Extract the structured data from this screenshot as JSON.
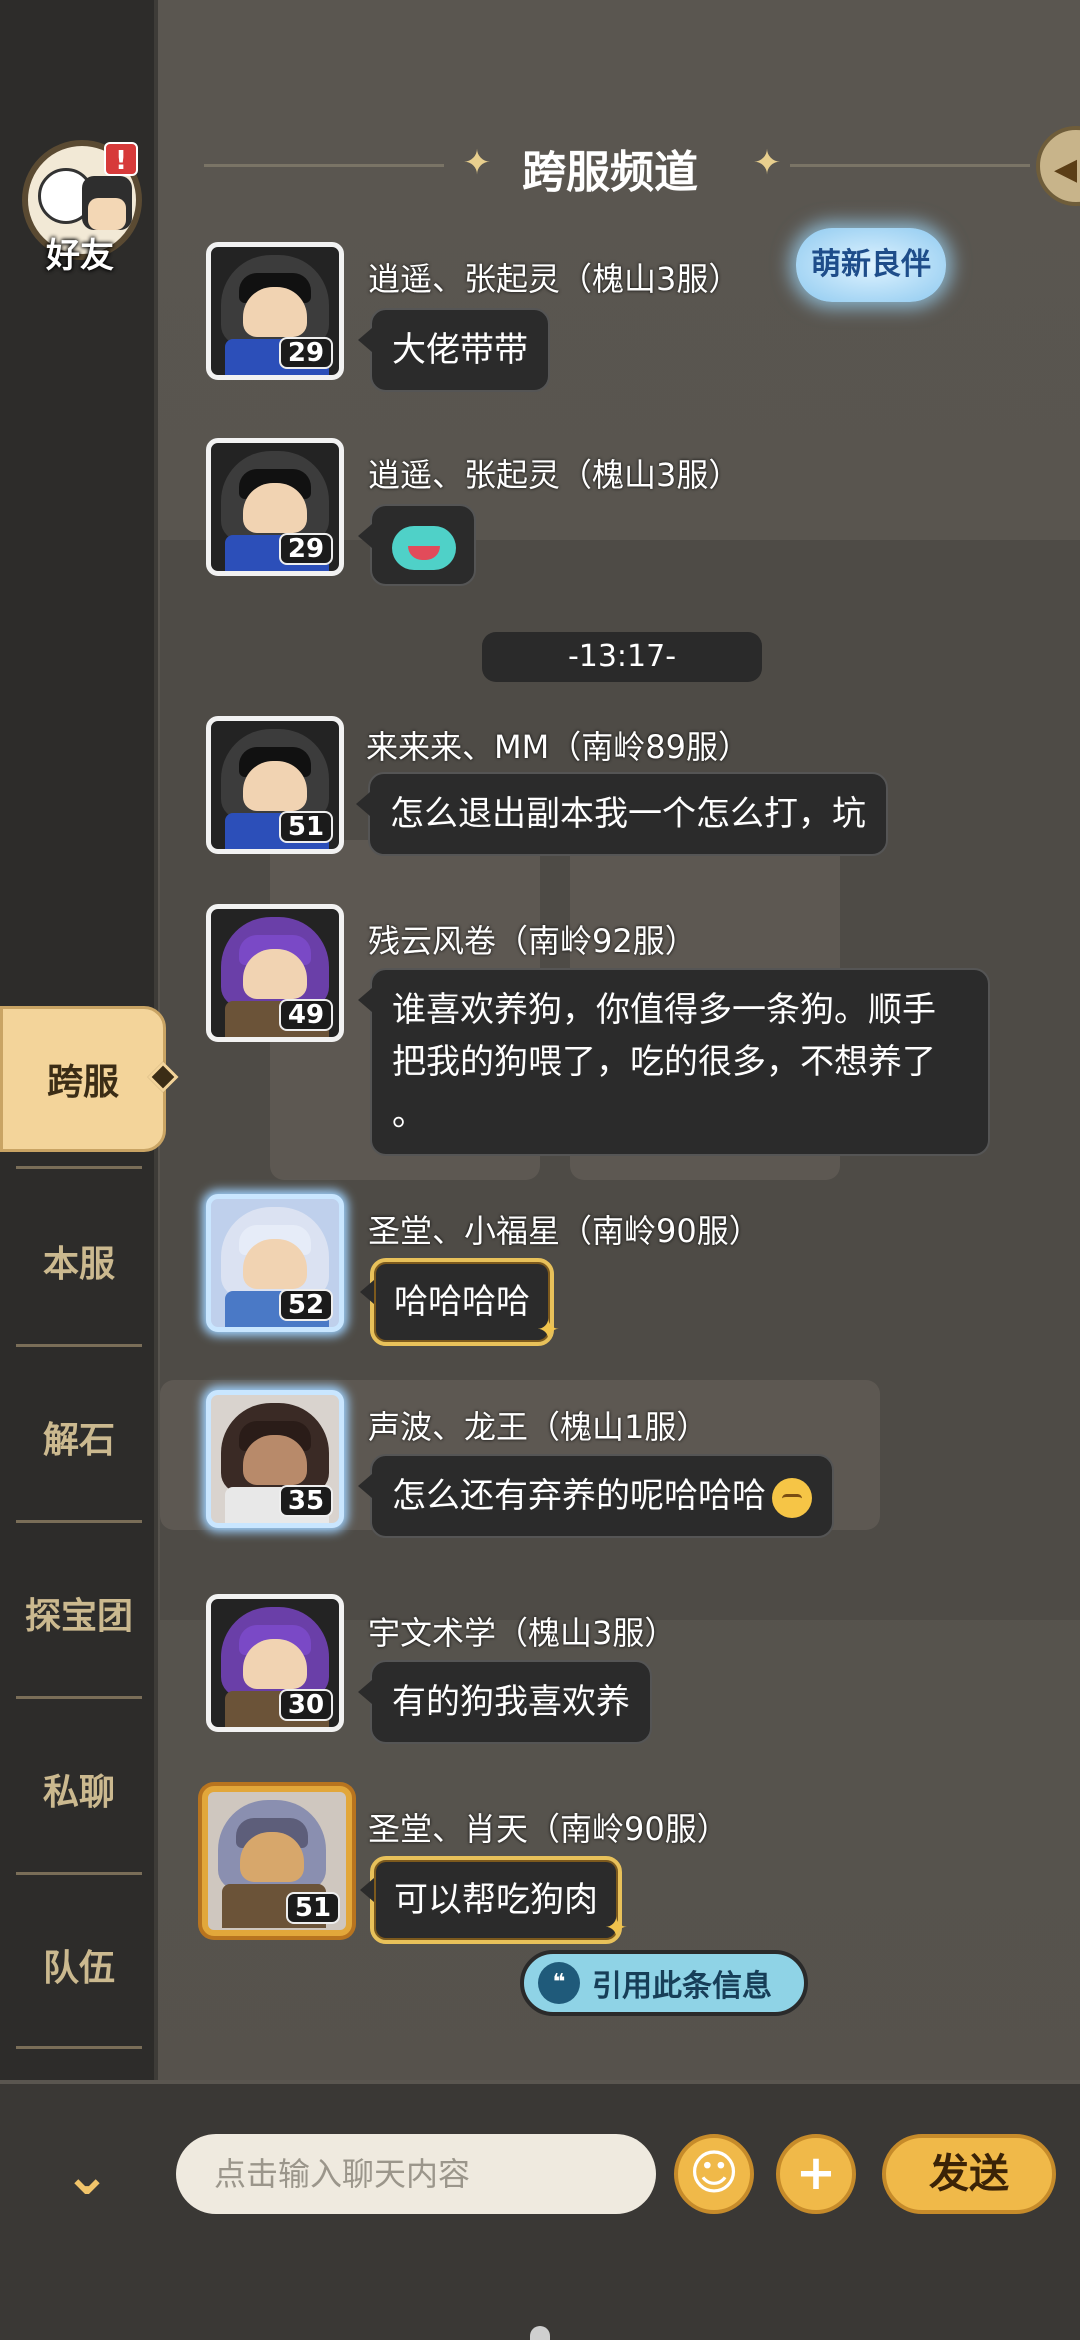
{
  "header": {
    "title": "跨服频道"
  },
  "friend": {
    "label": "好友",
    "badge": "!"
  },
  "sidebar": {
    "tabs": [
      {
        "label": "跨服",
        "active": true
      },
      {
        "label": "本服"
      },
      {
        "label": "解石"
      },
      {
        "label": "探宝团"
      },
      {
        "label": "私聊"
      },
      {
        "label": "队伍"
      }
    ]
  },
  "badge": {
    "mengxin": "萌新良伴"
  },
  "time_divider": "-13:17-",
  "messages": [
    {
      "sender": "逍遥、张起灵（槐山3服）",
      "level": "29",
      "text": "大佬带带"
    },
    {
      "sender": "逍遥、张起灵（槐山3服）",
      "level": "29",
      "text": ""
    },
    {
      "sender": "来来来、MM（南岭89服）",
      "level": "51",
      "text": "怎么退出副本我一个怎么打，坑"
    },
    {
      "sender": "残云风卷（南岭92服）",
      "level": "49",
      "line1": "谁喜欢养狗，你值得多一条狗。顺手",
      "line2": "把我的狗喂了，吃的很多，不想养了",
      "line3": "。"
    },
    {
      "sender": "圣堂、小福星（南岭90服）",
      "level": "52",
      "text": "哈哈哈哈"
    },
    {
      "sender": "声波、龙王（槐山1服）",
      "level": "35",
      "text": "怎么还有弃养的呢哈哈哈"
    },
    {
      "sender": "宇文术学（槐山3服）",
      "level": "30",
      "text": "有的狗我喜欢养"
    },
    {
      "sender": "圣堂、肖天（南岭90服）",
      "level": "51",
      "text": "可以帮吃狗肉"
    }
  ],
  "quote_button": "引用此条信息",
  "input": {
    "placeholder": "点击输入聊天内容"
  },
  "send_label": "发送",
  "icons": {
    "collapse": "chevron-down-icon",
    "emoji": "smiley-icon",
    "more": "plus-icon",
    "quote": "speech-bubble-icon"
  },
  "colors": {
    "accent": "#f0b949",
    "active_tab": "#f3d49a"
  }
}
